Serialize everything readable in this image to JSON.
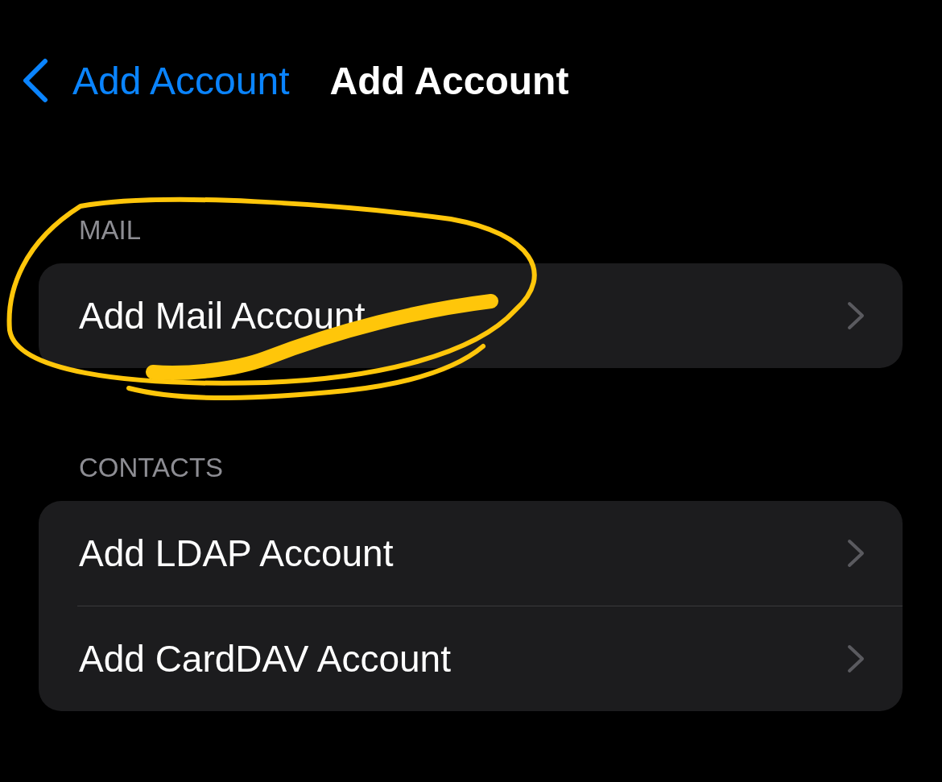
{
  "nav": {
    "back_label": "Add Account",
    "title": "Add Account"
  },
  "sections": [
    {
      "header": "MAIL",
      "rows": [
        {
          "label": "Add Mail Account"
        }
      ]
    },
    {
      "header": "CONTACTS",
      "rows": [
        {
          "label": "Add LDAP Account"
        },
        {
          "label": "Add CardDAV Account"
        }
      ]
    }
  ],
  "annotation": {
    "kind": "scribble"
  }
}
